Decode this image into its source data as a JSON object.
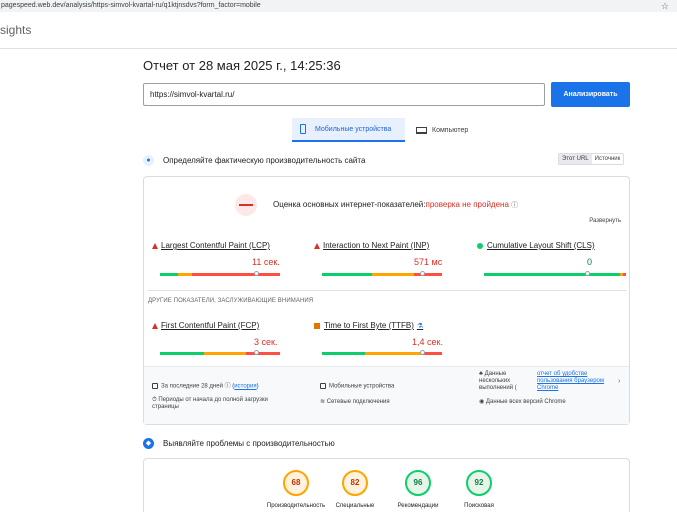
{
  "browser": {
    "url": "pagespeed.web.dev/analysis/https-simvol-kvartal-ru/q1ktjnsdvs?form_factor=mobile",
    "star_icon": "☆"
  },
  "app": {
    "brand_fragment": "sights"
  },
  "report": {
    "title": "Отчет от 28 мая 2025 г., 14:25:36",
    "url_value": "https://simvol-kvartal.ru/",
    "analyze_label": "Анализировать"
  },
  "tabs": {
    "mobile": "Мобильные устройства",
    "desktop": "Компьютер"
  },
  "field": {
    "heading": "Определяйте фактическую производительность сайта",
    "toggle_url": "Этот URL",
    "toggle_origin": "Источник",
    "cwv_title_prefix": "Оценка основных интернет-показателей:",
    "cwv_status": "проверка не пройдена",
    "expand_label": "Развернуть",
    "metrics": {
      "lcp": {
        "label": "Largest Contentful Paint (LCP)",
        "value": "11 сек."
      },
      "inp": {
        "label": "Interaction to Next Paint (INP)",
        "value": "571 мс"
      },
      "cls": {
        "label": "Cumulative Layout Shift (CLS)",
        "value": "0"
      },
      "fcp": {
        "label": "First Contentful Paint (FCP)",
        "value": "3 сек."
      },
      "ttfb": {
        "label": "Time to First Byte (TTFB)",
        "value": "1,4 сек."
      }
    },
    "other_heading": "ДРУГИЕ ПОКАЗАТЕЛИ, ЗАСЛУЖИВАЮЩИЕ ВНИМАНИЯ",
    "footer": {
      "period_prefix": "За последние 28 дней",
      "history_link": "история",
      "devices": "Мобильные устройства",
      "samples": "Данные нескольких выполнений (",
      "report_link": "отчет об удобстве пользования браузером Chrome",
      "periods": "Периоды от начала до полной загрузки страницы",
      "network": "Сетевые подключения",
      "all_versions": "Данные всех версий Chrome"
    }
  },
  "diagnose": {
    "heading": "Выявляйте проблемы с производительностью",
    "categories": [
      {
        "label": "Производительность",
        "score": "68",
        "tone": "orange"
      },
      {
        "label": "Специальные",
        "score": "82",
        "tone": "orange"
      },
      {
        "label": "Рекомендации",
        "score": "96",
        "tone": "green"
      },
      {
        "label": "Поисковая",
        "score": "92",
        "tone": "green"
      }
    ]
  }
}
